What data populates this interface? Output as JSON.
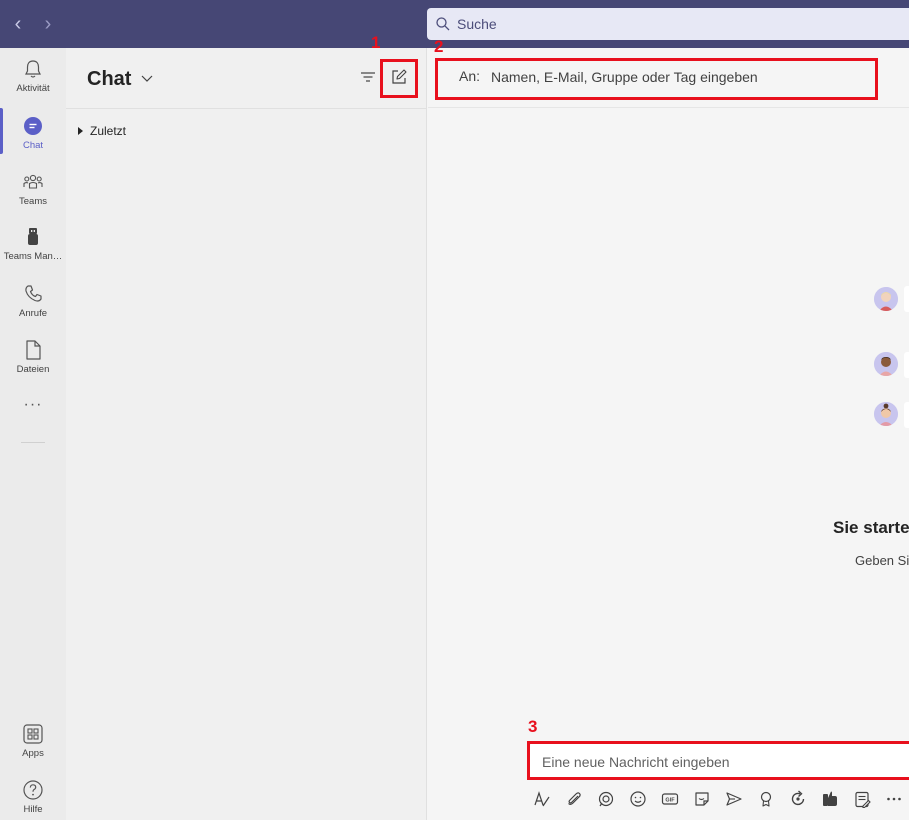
{
  "nav": {
    "back": "‹",
    "forward": "›"
  },
  "search": {
    "placeholder": "Suche"
  },
  "rail": {
    "items": [
      {
        "label": "Aktivität",
        "icon": "bell-icon"
      },
      {
        "label": "Chat",
        "icon": "chat-icon",
        "active": true
      },
      {
        "label": "Teams",
        "icon": "teams-icon"
      },
      {
        "label": "Teams Man…",
        "icon": "usb-icon"
      },
      {
        "label": "Anrufe",
        "icon": "phone-icon"
      },
      {
        "label": "Dateien",
        "icon": "file-icon"
      }
    ],
    "more": "···",
    "apps": {
      "label": "Apps",
      "icon": "apps-icon"
    },
    "help": {
      "label": "Hilfe",
      "icon": "help-icon"
    }
  },
  "chatpane": {
    "title": "Chat",
    "recent_label": "Zuletzt"
  },
  "to_bar": {
    "label": "An:",
    "placeholder": "Namen, E-Mail, Gruppe oder Tag eingeben"
  },
  "empty_state": {
    "title": "Sie starte",
    "subtitle": "Geben Si"
  },
  "compose": {
    "placeholder": "Eine neue Nachricht eingeben"
  },
  "annotations": [
    "1",
    "2",
    "3"
  ],
  "colors": {
    "topbar": "#464775",
    "accent": "#5b5fc7",
    "annotation": "#e8101d"
  }
}
